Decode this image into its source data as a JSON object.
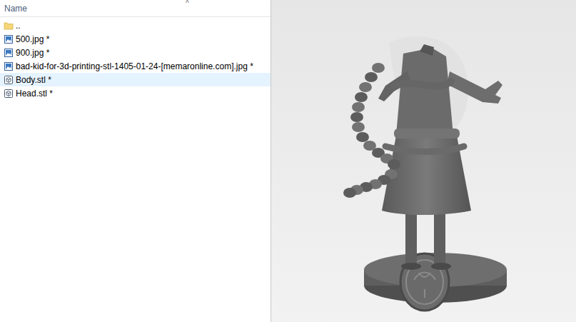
{
  "file_list": {
    "header": {
      "label": "Name",
      "sort_indicator": "^"
    },
    "files": [
      {
        "name": "..",
        "kind": "folder",
        "selected": false
      },
      {
        "name": "500.jpg *",
        "kind": "image",
        "selected": false
      },
      {
        "name": "900.jpg *",
        "kind": "image",
        "selected": false
      },
      {
        "name": "bad-kid-for-3d-printing-stl-1405-01-24-[memaronline.com].jpg *",
        "kind": "image",
        "selected": false
      },
      {
        "name": "Body.stl *",
        "kind": "model",
        "selected": true
      },
      {
        "name": "Head.stl *",
        "kind": "model",
        "selected": false
      }
    ]
  }
}
